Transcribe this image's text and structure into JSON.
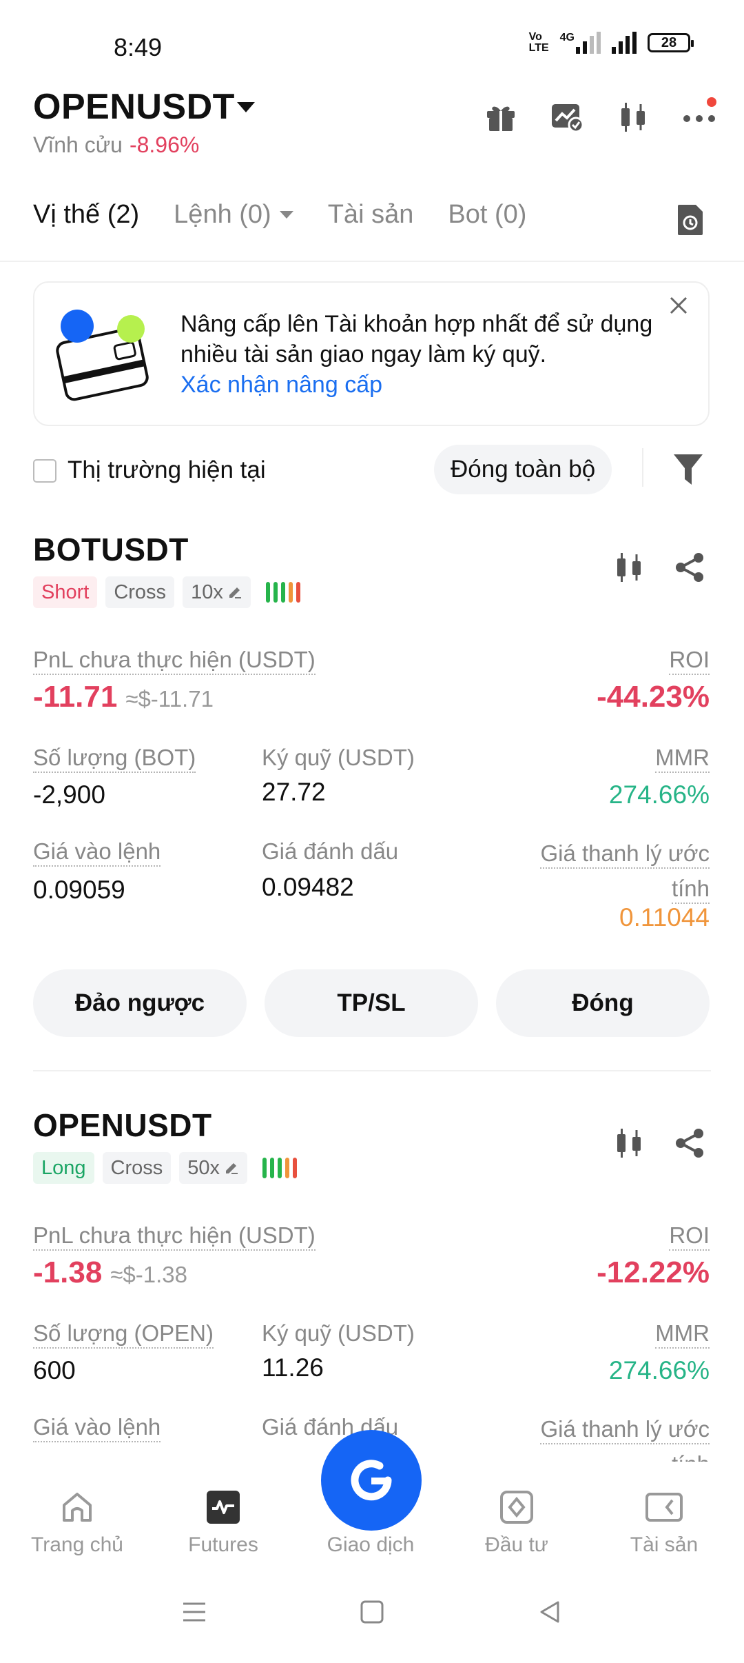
{
  "status_bar": {
    "time": "8:49",
    "volte": "Vo\nLTE",
    "network": "4G",
    "battery": "28"
  },
  "header": {
    "pair": "OPENUSDT",
    "type": "Vĩnh cửu",
    "change": "-8.96%"
  },
  "tabs": [
    {
      "label": "Vị thế (2)"
    },
    {
      "label": "Lệnh (0)"
    },
    {
      "label": "Tài sản"
    },
    {
      "label": "Bot (0)"
    }
  ],
  "banner": {
    "text": "Nâng cấp lên Tài khoản hợp nhất để sử dụng nhiều tài sản giao ngay làm ký quỹ.",
    "link": "Xác nhận nâng cấp"
  },
  "toolbar": {
    "checkbox_label": "Thị trường hiện tại",
    "close_all": "Đóng toàn bộ"
  },
  "positions": [
    {
      "symbol": "BOTUSDT",
      "side": "Short",
      "margin_mode": "Cross",
      "leverage": "10x",
      "pnl_label": "PnL chưa thực hiện (USDT)",
      "pnl": "-11.71",
      "pnl_usd": "≈$-11.71",
      "roi_label": "ROI",
      "roi": "-44.23%",
      "qty_label": "Số lượng (BOT)",
      "qty": "-2,900",
      "margin_label": "Ký quỹ (USDT)",
      "margin": "27.72",
      "mmr_label": "MMR",
      "mmr": "274.66%",
      "entry_label": "Giá vào lệnh",
      "entry": "0.09059",
      "mark_label": "Giá đánh dấu",
      "mark": "0.09482",
      "liq_label": "Giá thanh lý ước tính",
      "liq": "0.11044",
      "btn_reverse": "Đảo ngược",
      "btn_tpsl": "TP/SL",
      "btn_close": "Đóng"
    },
    {
      "symbol": "OPENUSDT",
      "side": "Long",
      "margin_mode": "Cross",
      "leverage": "50x",
      "pnl_label": "PnL chưa thực hiện (USDT)",
      "pnl": "-1.38",
      "pnl_usd": "≈$-1.38",
      "roi_label": "ROI",
      "roi": "-12.22%",
      "qty_label": "Số lượng (OPEN)",
      "qty": "600",
      "margin_label": "Ký quỹ (USDT)",
      "margin": "11.26",
      "mmr_label": "MMR",
      "mmr": "274.66%",
      "entry_label": "Giá vào lệnh",
      "mark_label": "Giá đánh dấu",
      "liq_label": "Giá thanh lý ước tính"
    }
  ],
  "bottom_nav": [
    {
      "label": "Trang chủ",
      "icon": "home-icon"
    },
    {
      "label": "Futures",
      "icon": "futures-icon"
    },
    {
      "label": "Giao dịch",
      "icon": "trade-icon"
    },
    {
      "label": "Đầu tư",
      "icon": "invest-icon"
    },
    {
      "label": "Tài sản",
      "icon": "wallet-icon"
    }
  ],
  "colors": {
    "red": "#e2405e",
    "green": "#26b487",
    "orange": "#f0953b",
    "link": "#1a6ef0",
    "fab": "#1565f5"
  }
}
